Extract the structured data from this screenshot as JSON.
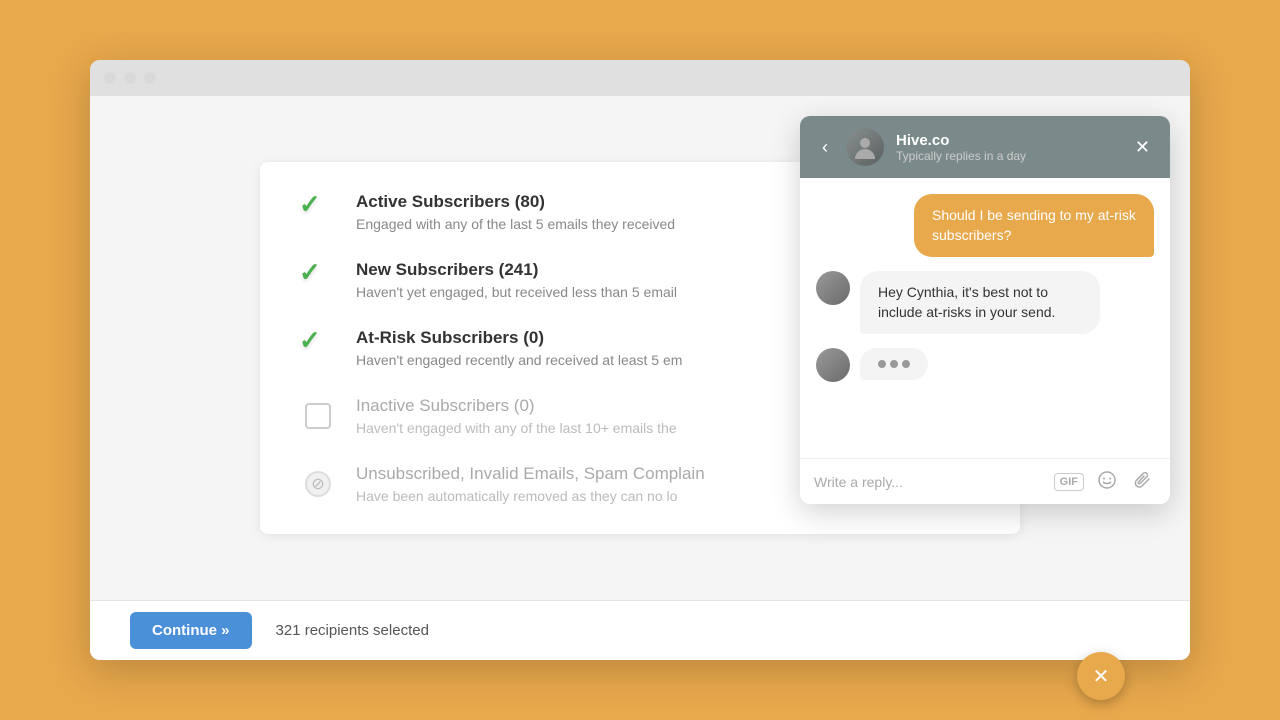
{
  "browser": {
    "dots": [
      "#ff5f56",
      "#ffbd2e",
      "#27c93f"
    ]
  },
  "subscribers": {
    "rows": [
      {
        "id": "active",
        "state": "checked",
        "title": "Active Subscribers (80)",
        "description": "Engaged with any of the last 5 emails they received",
        "muted": false
      },
      {
        "id": "new",
        "state": "checked",
        "title": "New Subscribers (241)",
        "description": "Haven't yet engaged, but received less than 5 email",
        "muted": false
      },
      {
        "id": "at-risk",
        "state": "checked",
        "title": "At-Risk Subscribers (0)",
        "description": "Haven't engaged recently and received at least 5 em",
        "muted": false
      },
      {
        "id": "inactive",
        "state": "empty",
        "title": "Inactive Subscribers (0)",
        "description": "Haven't engaged with any of the last 10+ emails the",
        "muted": true
      },
      {
        "id": "unsubscribed",
        "state": "disabled",
        "title": "Unsubscribed, Invalid Emails, Spam Complain",
        "description": "Have been automatically removed as they can no lo",
        "muted": true
      }
    ]
  },
  "bottom_bar": {
    "continue_label": "Continue »",
    "recipients_text": "321 recipients selected"
  },
  "chat": {
    "header": {
      "name": "Hive.co",
      "status": "Typically replies in a day"
    },
    "messages": [
      {
        "side": "right",
        "text": "Should I be sending to my at-risk subscribers?"
      },
      {
        "side": "left",
        "text": "Hey Cynthia, it's best not to include at-risks in your send."
      },
      {
        "side": "left",
        "text": "typing"
      }
    ],
    "input_placeholder": "Write a reply..."
  }
}
